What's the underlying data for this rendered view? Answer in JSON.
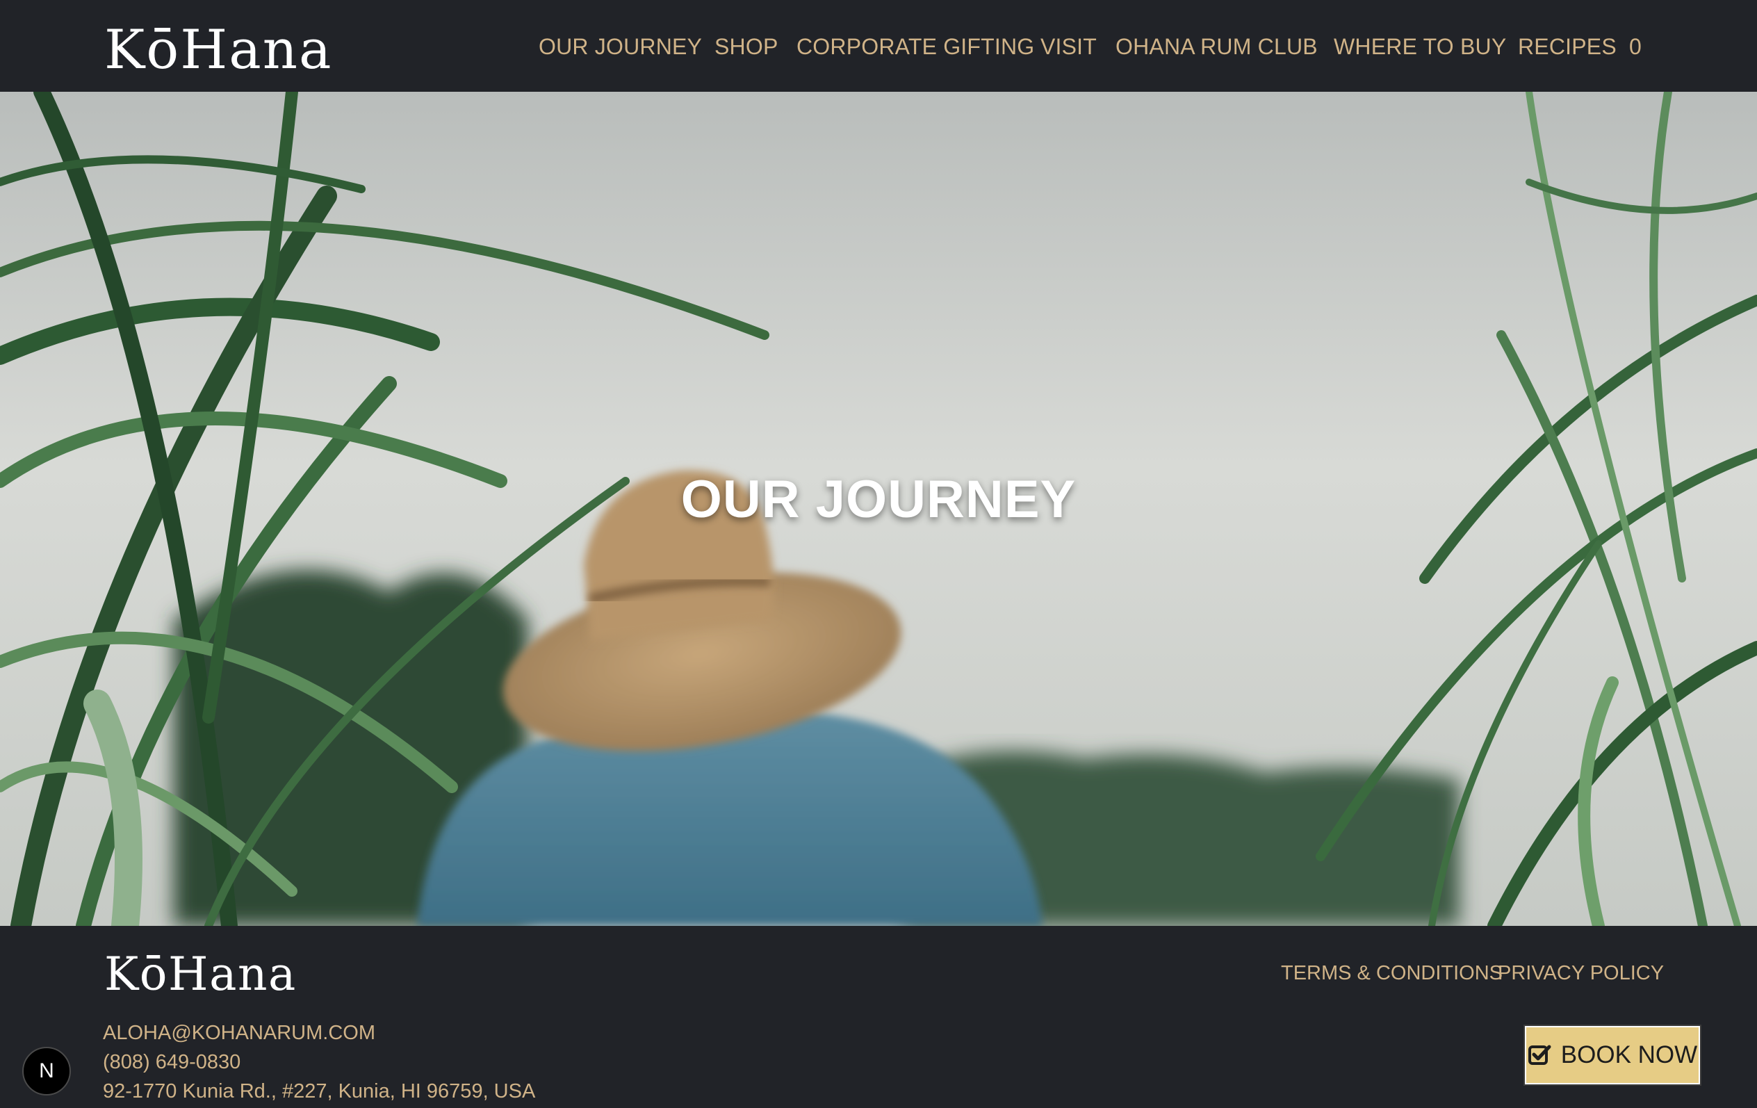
{
  "brand": {
    "logo_text": "KōHana"
  },
  "nav": {
    "items": [
      {
        "label": "OUR JOURNEY"
      },
      {
        "label": "SHOP"
      },
      {
        "label": "CORPORATE GIFTING"
      },
      {
        "label": "VISIT"
      },
      {
        "label": "OHANA RUM CLUB"
      },
      {
        "label": "WHERE TO BUY"
      },
      {
        "label": "RECIPES"
      }
    ],
    "cart_count": "0"
  },
  "hero": {
    "title": "OUR JOURNEY"
  },
  "footer": {
    "logo_text": "KōHana",
    "terms_label": "TERMS & CONDITIONS",
    "privacy_label": "PRIVACY POLICY",
    "email": "ALOHA@KOHANARUM.COM",
    "phone": "(808) 649-0830",
    "address": "92-1770 Kunia Rd., #227, Kunia, HI 96759, USA",
    "book_label": "BOOK NOW",
    "badge_letter": "N"
  },
  "colors": {
    "accent": "#d0b388",
    "background": "#212328",
    "button": "#e6cc85"
  },
  "icons": {
    "book": "checkbox-check-icon"
  }
}
